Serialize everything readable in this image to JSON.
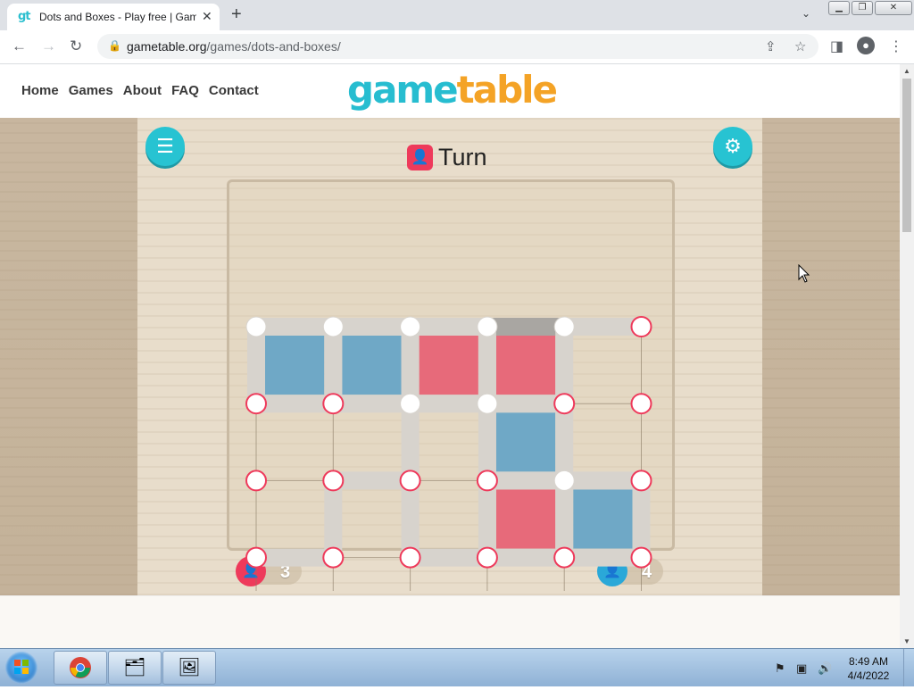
{
  "browser": {
    "tab_favicon": "gt",
    "tab_title": "Dots and Boxes - Play free | Gam",
    "url_domain": "gametable.org",
    "url_path": "/games/dots-and-boxes/",
    "icons": [
      "back-arrow-icon",
      "forward-arrow-icon",
      "reload-icon",
      "lock-icon",
      "share-icon",
      "star-icon",
      "side-panel-icon",
      "profile-icon",
      "kebab-menu-icon",
      "close-icon",
      "plus-icon",
      "chevron-down-icon"
    ]
  },
  "site": {
    "nav": [
      "Home",
      "Games",
      "About",
      "FAQ",
      "Contact"
    ],
    "logo_part1": "game",
    "logo_part2": "table"
  },
  "game": {
    "turn_label": "Turn",
    "turn_color": "#ee3a5b",
    "player_red_score": "3",
    "player_blue_score": "4",
    "red_color": "#ee3a5b",
    "blue_color": "#2aa8d8",
    "grid": {
      "rows": 5,
      "cols": 6
    },
    "hlines": [
      [
        1,
        1,
        1,
        1,
        1
      ],
      [
        1,
        1,
        1,
        1,
        0
      ],
      [
        0,
        1,
        0,
        1,
        1
      ],
      [
        1,
        0,
        1,
        1,
        1
      ],
      [
        0,
        0,
        0,
        0,
        0
      ]
    ],
    "vlines": [
      [
        1,
        1,
        1,
        1,
        1,
        0
      ],
      [
        0,
        0,
        1,
        1,
        1,
        0
      ],
      [
        0,
        1,
        1,
        1,
        1,
        1
      ],
      [
        0,
        0,
        0,
        0,
        0,
        0
      ]
    ],
    "boxes": [
      [
        "blue",
        "blue",
        "red",
        "red",
        ""
      ],
      [
        "",
        "",
        "",
        "blue",
        ""
      ],
      [
        "",
        "",
        "",
        "red",
        "blue"
      ],
      [
        "",
        "",
        "",
        "",
        ""
      ]
    ],
    "last_move": "h-0-3"
  },
  "taskbar": {
    "time": "8:49 AM",
    "date": "4/4/2022",
    "apps": [
      "chrome-icon",
      "file-explorer-icon",
      "image-viewer-icon"
    ]
  }
}
